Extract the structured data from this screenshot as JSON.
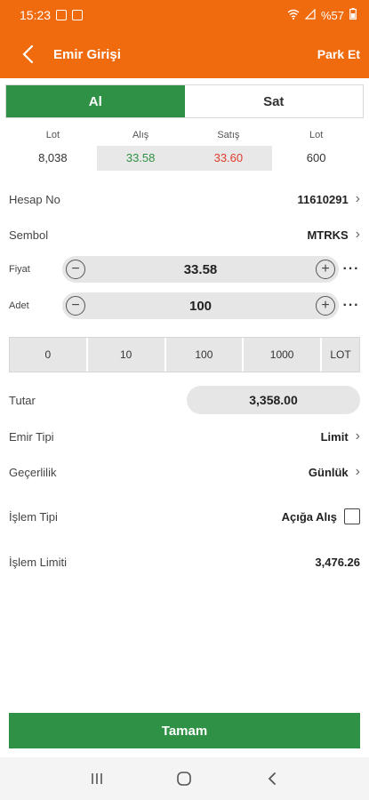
{
  "status_bar": {
    "time": "15:23",
    "battery": "%57"
  },
  "header": {
    "title": "Emir Girişi",
    "park_label": "Park Et",
    "back_icon": "chevron-left-icon"
  },
  "tabs": [
    {
      "label": "Al",
      "active": true
    },
    {
      "label": "Sat",
      "active": false
    }
  ],
  "quotes": {
    "lot_left_label": "Lot",
    "lot_left_value": "8,038",
    "alis_label": "Alış",
    "alis_value": "33.58",
    "satis_label": "Satış",
    "satis_value": "33.60",
    "lot_right_label": "Lot",
    "lot_right_value": "600"
  },
  "hesap": {
    "label": "Hesap No",
    "value": "11610291"
  },
  "sembol": {
    "label": "Sembol",
    "value": "MTRKS"
  },
  "fiyat": {
    "label": "Fiyat",
    "value": "33.58"
  },
  "adet": {
    "label": "Adet",
    "value": "100"
  },
  "quantity_buttons": [
    "0",
    "10",
    "100",
    "1000",
    "LOT"
  ],
  "tutar": {
    "label": "Tutar",
    "value": "3,358.00"
  },
  "emir_tipi": {
    "label": "Emir Tipi",
    "value": "Limit"
  },
  "gecerlilik": {
    "label": "Geçerlilik",
    "value": "Günlük"
  },
  "islem_tipi": {
    "label": "İşlem Tipi",
    "option_label": "Açığa Alış",
    "checked": false
  },
  "islem_limiti": {
    "label": "İşlem Limiti",
    "value": "3,476.26"
  },
  "submit_label": "Tamam",
  "colors": {
    "accent_orange": "#f06a0e",
    "buy_green": "#2e9145",
    "sell_red": "#e03b2c"
  }
}
